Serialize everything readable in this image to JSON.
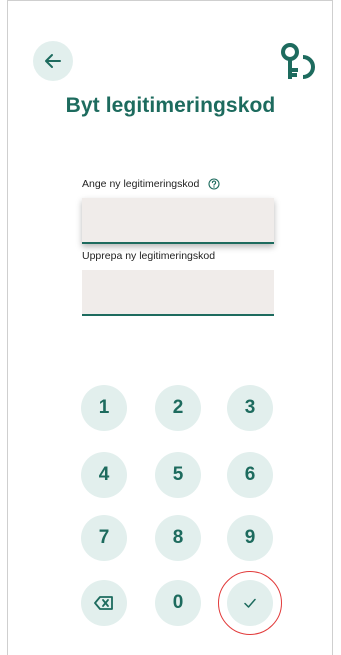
{
  "header": {
    "back_icon": "arrow-left-icon",
    "logo_icon": "key-logo-icon",
    "title": "Byt legitimeringskod"
  },
  "form": {
    "new_code_label": "Ange ny legitimeringskod",
    "new_code_value": "",
    "repeat_code_label": "Upprepa ny legitimeringskod",
    "repeat_code_value": "",
    "help_icon": "question-circle-icon"
  },
  "keypad": {
    "keys": [
      "1",
      "2",
      "3",
      "4",
      "5",
      "6",
      "7",
      "8",
      "9"
    ],
    "zero": "0",
    "backspace_icon": "backspace-icon",
    "confirm_icon": "checkmark-icon"
  },
  "colors": {
    "accent": "#1d6b5e",
    "key_bg": "#e2efed",
    "field_bg": "#f0ecea",
    "highlight": "#e23b3b"
  }
}
